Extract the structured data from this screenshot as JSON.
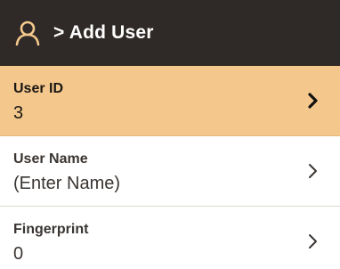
{
  "header": {
    "icon": "user-icon",
    "title": "> Add User",
    "background": "#2f2a27",
    "icon_color": "#f4c88c"
  },
  "menu": {
    "selected_color": "#f4c88c",
    "items": [
      {
        "label": "User ID",
        "value": "3",
        "selected": true,
        "icon": "chevron-right-icon"
      },
      {
        "label": "User Name",
        "value": "(Enter Name)",
        "selected": false,
        "icon": "chevron-right-icon"
      },
      {
        "label": "Fingerprint",
        "value": "0",
        "selected": false,
        "icon": "chevron-right-icon"
      }
    ]
  }
}
